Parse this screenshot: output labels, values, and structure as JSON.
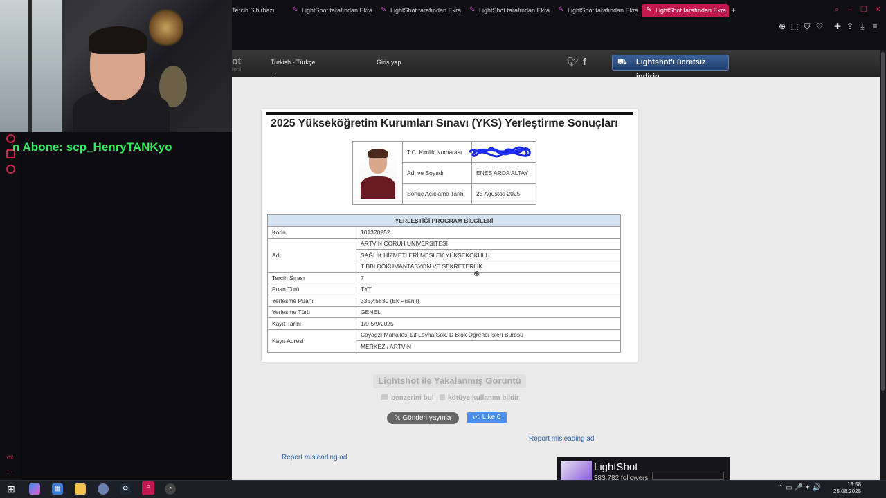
{
  "stream": {
    "subscriber_alert": "n Abone: scp_HenryTANKyo",
    "side_footer": [
      "ox",
      "..."
    ]
  },
  "browser": {
    "tabs": [
      {
        "label": "Tercih Sihirbazı",
        "icon": ""
      },
      {
        "label": "LightShot tarafından Ekra",
        "icon": "feather-icon"
      },
      {
        "label": "LightShot tarafından Ekra",
        "icon": "feather-icon"
      },
      {
        "label": "LightShot tarafından Ekra",
        "icon": "feather-icon"
      },
      {
        "label": "LightShot tarafından Ekra",
        "icon": "feather-icon"
      },
      {
        "label": "LightShot tarafından Ekra",
        "icon": "feather-icon"
      }
    ],
    "new_tab_symbol": "+",
    "accent_color": "#c2184f"
  },
  "lightshot": {
    "logo": "ot",
    "logo_sub": "tool",
    "language": "Turkish - Türkçe",
    "language_arrow": "⌄",
    "login": "Giriş yap",
    "download_button": "Lightshot'ı ücretsiz indirin",
    "caption": "Lightshot ile Yakalanmış Görüntü",
    "find_similar": "benzerini bul",
    "report_abuse": "kötüye kullanım bildir",
    "tweet_button": "Gönderi yayınla",
    "like_button": "Like 0",
    "misleading_ad_1": "Report misleading ad",
    "misleading_ad_2": "Report misleading ad",
    "fb_page_name": "LightShot",
    "fb_followers": "383,782 followers"
  },
  "result": {
    "title": "2025 Yükseköğretim Kurumları Sınavı (YKS) Yerleştirme Sonuçları",
    "id_rows": [
      {
        "label": "T.C. Kimlik Numarası",
        "value": ""
      },
      {
        "label": "Adı ve Soyadı",
        "value": "ENES ARDA ALTAY"
      },
      {
        "label": "Sonuç Açıklama Tarihi",
        "value": "25 Ağustos 2025"
      }
    ],
    "program_header": "YERLEŞTİĞİ PROGRAM BİLGİLERİ",
    "code_label": "Kodu",
    "code_value": "101370252",
    "name_label": "Adı",
    "name_lines": [
      "ARTVİN ÇORUH ÜNİVERSİTESİ",
      "SAĞLIK HİZMETLERİ MESLEK YÜKSEKOKULU",
      "TIBBİ DOKÜMANTASYON VE SEKRETERLİK"
    ],
    "rows": [
      {
        "label": "Tercih Sırası",
        "value": "7"
      },
      {
        "label": "Puan Türü",
        "value": "TYT"
      },
      {
        "label": "Yerleşme Puanı",
        "value": "335,45830 (Ek Puanlı)"
      },
      {
        "label": "Yerleşme Türü",
        "value": "GENEL"
      },
      {
        "label": "Kayıt Tarihi",
        "value": "1/9-5/9/2025"
      }
    ],
    "address_label": "Kayıt Adresi",
    "address_lines": [
      "Çayağzı Mahallesi Lif Levha Sok. D Blok Öğrenci İşleri Bürosu",
      "MERKEZ / ARTVİN"
    ]
  },
  "taskbar": {
    "time": "13:58",
    "date": "25.08.2025",
    "tray": "⌃  ▭  🎤  ✶  🔊"
  }
}
